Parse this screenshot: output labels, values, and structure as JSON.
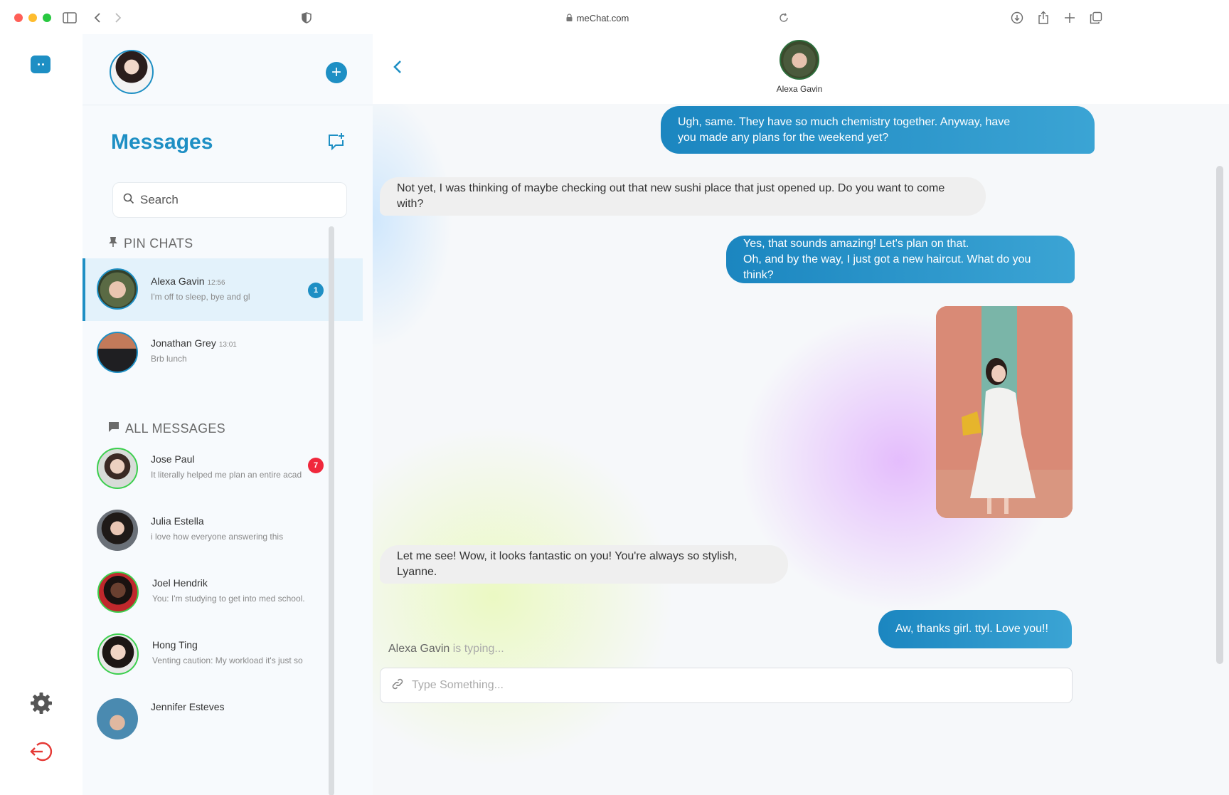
{
  "browser": {
    "url": "meChat.com",
    "icons": [
      "sidebar-toggle-icon",
      "back-arrow-icon",
      "forward-arrow-icon",
      "shield-icon",
      "lock-icon",
      "reload-icon",
      "download-icon",
      "share-icon",
      "new-tab-icon",
      "tabs-overview-icon"
    ]
  },
  "rail": {
    "icons": [
      "app-logo-icon",
      "settings-icon",
      "logout-icon"
    ],
    "accent": "#1e8fc4",
    "logout_color": "#e53935"
  },
  "sidebar": {
    "title": "Messages",
    "search_placeholder": "Search",
    "pin_label": "PIN CHATS",
    "all_label": "ALL MESSAGES",
    "pinned": [
      {
        "name": "Alexa Gavin",
        "time": "12:56",
        "preview": "I'm off to sleep, bye and gl",
        "badge": "1"
      },
      {
        "name": "Jonathan Grey",
        "time": "13:01",
        "preview": "Brb lunch",
        "badge": ""
      }
    ],
    "all": [
      {
        "name": "Jose Paul",
        "time": "",
        "preview": "It literally helped me plan an entire acad",
        "badge": "7"
      },
      {
        "name": "Julia Estella",
        "time": "",
        "preview": "i love how everyone answering this",
        "badge": ""
      },
      {
        "name": "Joel Hendrik",
        "time": "",
        "preview": "You: I'm studying to get into med school.",
        "badge": ""
      },
      {
        "name": "Hong Ting",
        "time": "",
        "preview": "Venting caution: My workload it's just so",
        "badge": ""
      },
      {
        "name": "Jennifer Esteves",
        "time": "",
        "preview": "",
        "badge": ""
      }
    ]
  },
  "chat": {
    "peer_name": "Alexa Gavin",
    "messages": [
      {
        "dir": "out",
        "lines": [
          "Ugh, same. They have so much chemistry together. Anyway, have",
          "you made any plans for the weekend yet?"
        ]
      },
      {
        "dir": "in",
        "lines": [
          "Not yet, I was thinking of maybe checking out that new sushi place that just opened up. Do you want to come with?"
        ]
      },
      {
        "dir": "out",
        "lines": [
          "Yes, that sounds amazing! Let's plan on that.",
          "Oh, and by the way, I just got a new haircut. What do you think?"
        ]
      },
      {
        "dir": "in",
        "lines": [
          "Let me see! Wow, it looks fantastic on you! You're always so stylish, Lyanne."
        ]
      },
      {
        "dir": "out",
        "lines": [
          "Aw, thanks girl. ttyl. Love you!!"
        ]
      }
    ],
    "typing_name": "Alexa Gavin",
    "typing_text": "is typing...",
    "composer_placeholder": "Type Something..."
  }
}
